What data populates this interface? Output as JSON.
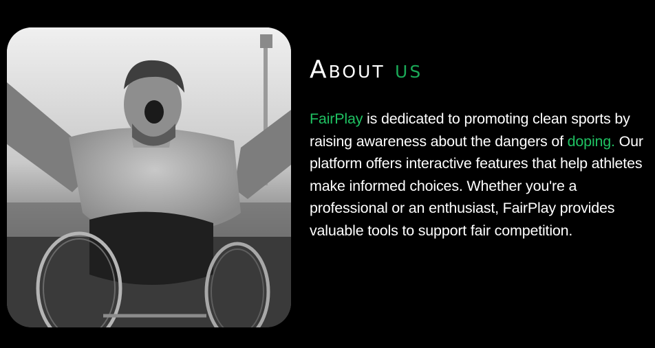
{
  "about": {
    "title_main": "About",
    "title_accent": "us",
    "brand_name": "FairPlay",
    "text_part1": " is dedicated to promoting clean sports by raising awareness about the dangers of ",
    "highlight_word": "doping.",
    "text_part2": " Our platform offers interactive features that help athletes make informed choices. Whether you're a professional or an enthusiast, FairPlay provides valuable tools to support fair competition."
  },
  "image": {
    "alt": "Athlete in wheelchair celebrating with arms raised"
  },
  "colors": {
    "background": "#000000",
    "accent_green": "#1fc162",
    "text": "#ffffff"
  }
}
